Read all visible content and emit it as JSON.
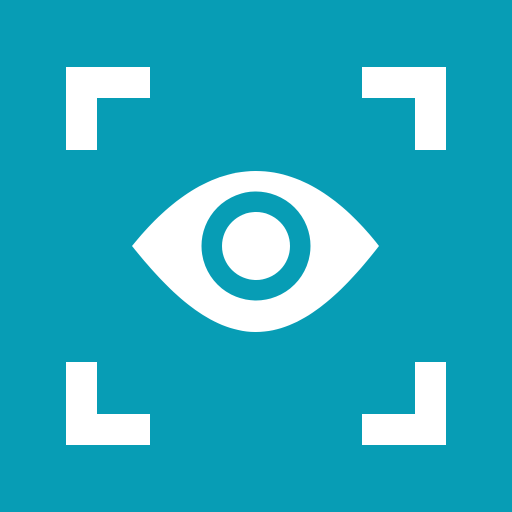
{
  "icon": {
    "name": "eye-scan-icon",
    "colors": {
      "background": "#079DB5",
      "foreground": "#FFFFFF"
    },
    "parts": {
      "frame": "viewfinder-corner-brackets",
      "center": "eye-icon"
    }
  }
}
